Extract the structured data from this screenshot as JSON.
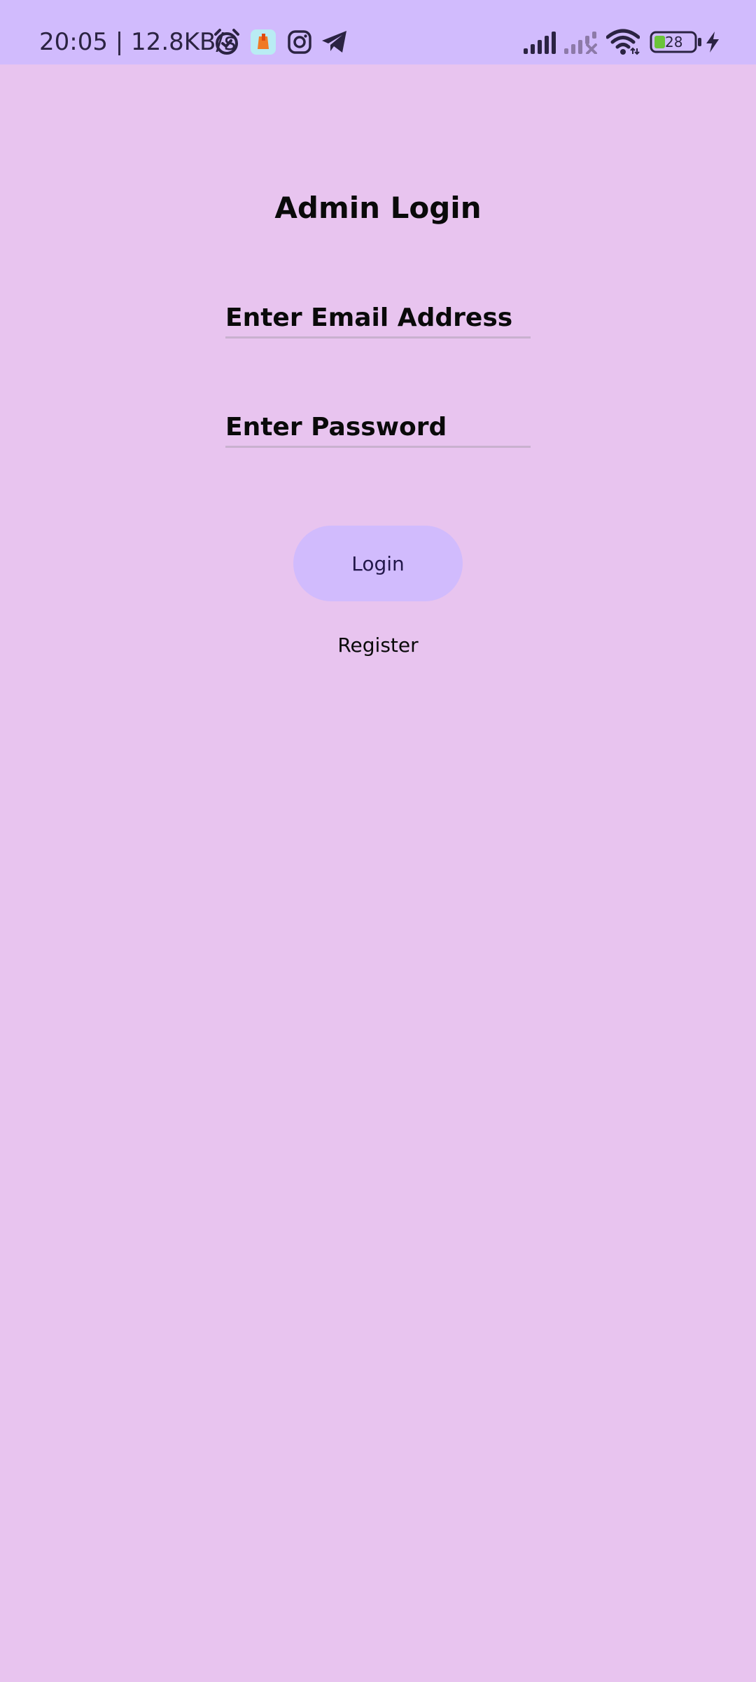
{
  "status_bar": {
    "time": "20:05 | 12.8KB/s",
    "battery_level": "28",
    "icons": [
      "alarm-icon",
      "app-notification-icon",
      "instagram-icon",
      "telegram-icon",
      "signal-icon",
      "signal-no-service-icon",
      "wifi-icon",
      "battery-icon",
      "charging-icon"
    ],
    "colors": {
      "background": "#d1bbfd",
      "foreground": "#2b2342",
      "battery_fill": "#6bc43a"
    }
  },
  "page": {
    "title": "Admin Login",
    "background": "#e8c4ef"
  },
  "form": {
    "email_placeholder": "Enter Email Address",
    "password_placeholder": "Enter Password",
    "login_label": "Login",
    "register_label": "Register",
    "button_color": "#d1bbfd"
  }
}
